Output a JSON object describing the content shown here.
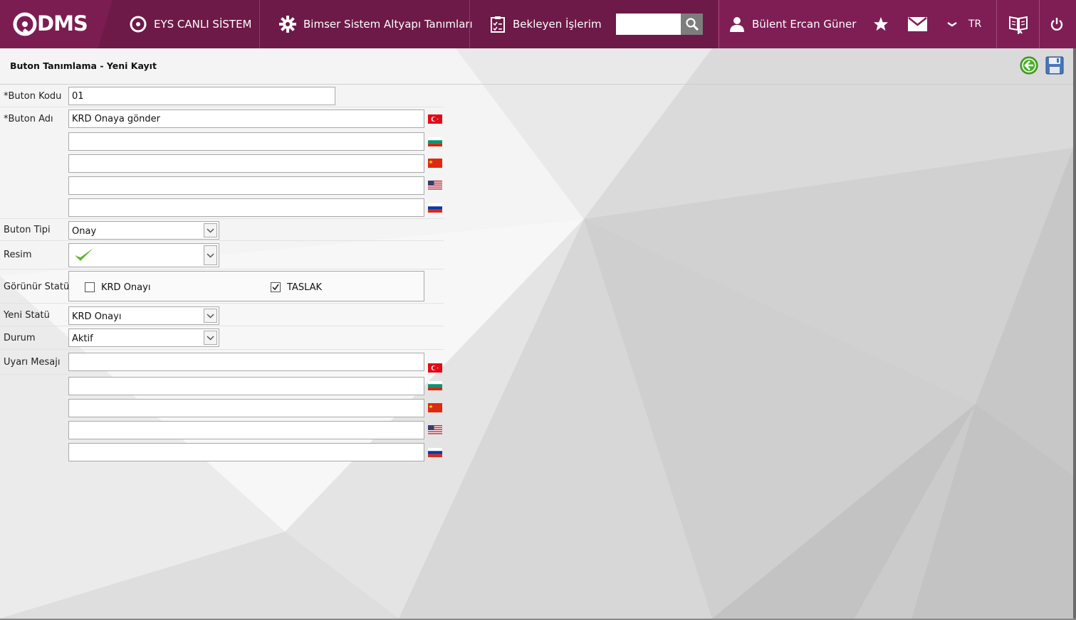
{
  "header": {
    "logo_text": "DMS",
    "nav": [
      {
        "label": "EYS CANLI SİSTEM",
        "icon": "q-circle-icon"
      },
      {
        "label": "Bimser Sistem Altyapı Tanımları",
        "icon": "gear-icon"
      },
      {
        "label": "Bekleyen İşlerim",
        "icon": "clipboard-icon"
      }
    ],
    "search": {
      "value": "",
      "placeholder": ""
    },
    "user_name": "Bülent Ercan Güner",
    "language": "TR"
  },
  "page": {
    "title": "Buton Tanımlama - Yeni Kayıt"
  },
  "form": {
    "buton_kodu": {
      "label": "*Buton Kodu",
      "value": "01"
    },
    "buton_adi": {
      "label": "*Buton Adı",
      "values": [
        {
          "lang": "tr",
          "value": "KRD Onaya gönder"
        },
        {
          "lang": "bg",
          "value": ""
        },
        {
          "lang": "cn",
          "value": ""
        },
        {
          "lang": "us",
          "value": ""
        },
        {
          "lang": "ru",
          "value": ""
        }
      ]
    },
    "buton_tipi": {
      "label": "Buton Tipi",
      "value": "Onay"
    },
    "resim": {
      "label": "Resim",
      "value_icon": "green-check-icon"
    },
    "gorunur_statu": {
      "label": "Görünür Statü",
      "options": [
        {
          "label": "KRD Onayı",
          "checked": false
        },
        {
          "label": "TASLAK",
          "checked": true
        }
      ]
    },
    "yeni_statu": {
      "label": "Yeni Statü",
      "value": "KRD Onayı"
    },
    "durum": {
      "label": "Durum",
      "value": "Aktif"
    },
    "uyari_mesaji": {
      "label": "Uyarı Mesajı",
      "values": [
        {
          "lang": "tr",
          "value": ""
        },
        {
          "lang": "bg",
          "value": ""
        },
        {
          "lang": "cn",
          "value": ""
        },
        {
          "lang": "us",
          "value": ""
        },
        {
          "lang": "ru",
          "value": ""
        }
      ]
    }
  },
  "colors": {
    "topbar": "#6d1a48",
    "accent": "#7e1e55",
    "back_button": "#4caf2a"
  }
}
